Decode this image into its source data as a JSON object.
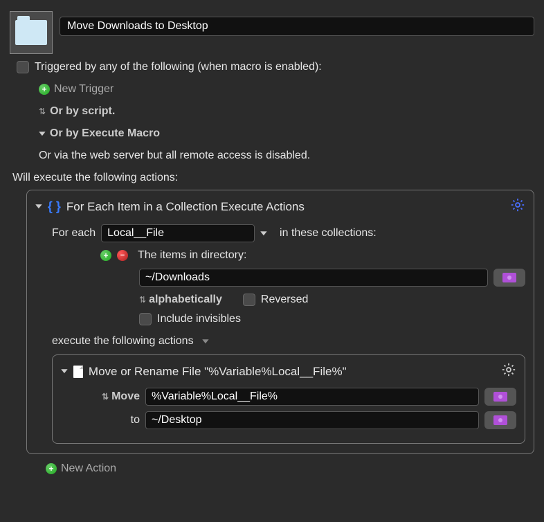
{
  "macro": {
    "title": "Move Downloads to Desktop"
  },
  "triggers": {
    "header": "Triggered by any of the following (when macro is enabled):",
    "new_trigger": "New Trigger",
    "by_script": "Or by script.",
    "by_execute_macro": "Or by Execute Macro",
    "web_server_note": "Or via the web server but all remote access is disabled."
  },
  "actions_header": "Will execute the following actions:",
  "foreach": {
    "title": "For Each Item in a Collection Execute Actions",
    "for_each_label": "For each",
    "variable": "Local__File",
    "in_these_label": "in these collections:",
    "items_label": "The items in directory:",
    "directory": "~/Downloads",
    "sort": "alphabetically",
    "reversed_label": "Reversed",
    "include_invisibles_label": "Include invisibles",
    "execute_label": "execute the following actions"
  },
  "move_action": {
    "title": "Move or Rename File \"%Variable%Local__File%\"",
    "move_label": "Move",
    "source": "%Variable%Local__File%",
    "to_label": "to",
    "destination": "~/Desktop"
  },
  "new_action": "New Action"
}
